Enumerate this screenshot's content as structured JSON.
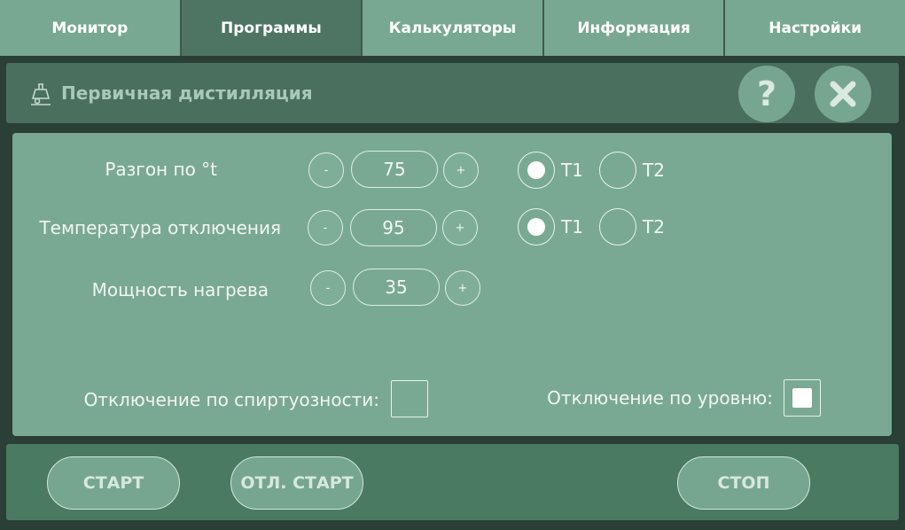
{
  "tabs": [
    {
      "label": "Монитор",
      "active": false
    },
    {
      "label": "Программы",
      "active": true
    },
    {
      "label": "Калькуляторы",
      "active": false
    },
    {
      "label": "Информация",
      "active": false
    },
    {
      "label": "Настройки",
      "active": false
    }
  ],
  "header": {
    "title": "Первичная дистилляция",
    "icon": "distiller-icon",
    "help_label": "?",
    "close_icon": "close-icon"
  },
  "settings": {
    "rows": [
      {
        "label": "Разгон по °t",
        "minus": "-",
        "value": "75",
        "plus": "+",
        "radio": [
          {
            "label": "T1",
            "selected": true
          },
          {
            "label": "T2",
            "selected": false
          }
        ]
      },
      {
        "label": "Температура отключения",
        "minus": "-",
        "value": "95",
        "plus": "+",
        "radio": [
          {
            "label": "T1",
            "selected": true
          },
          {
            "label": "T2",
            "selected": false
          }
        ]
      },
      {
        "label": "Мощность нагрева",
        "minus": "-",
        "value": "35",
        "plus": "+"
      }
    ],
    "alcohol_cutoff": {
      "label": "Отключение по спиртуозности:",
      "checked": false
    },
    "level_cutoff": {
      "label": "Отключение по уровню:",
      "checked": true
    }
  },
  "actions": {
    "start": "СТАРТ",
    "delayed_start": "ОТЛ. СТАРТ",
    "stop": "СТОП"
  },
  "colors": {
    "tab_bg": "#78a891",
    "tab_active": "#4e7563",
    "panel_bg": "#7aa993",
    "header_bg": "#4b6f5f",
    "bottom_bg": "#4b7a62"
  }
}
